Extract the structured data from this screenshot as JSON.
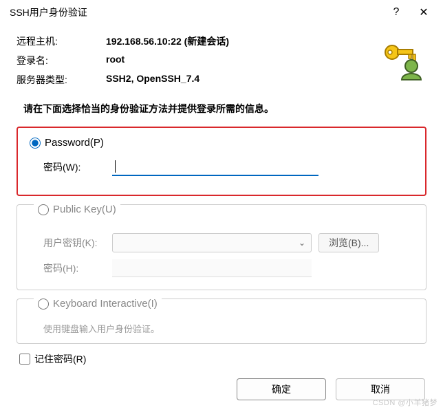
{
  "titlebar": {
    "title": "SSH用户身份验证",
    "help_glyph": "?",
    "close_glyph": "✕"
  },
  "info": {
    "remote_host_label": "远程主机:",
    "remote_host_value": "192.168.56.10:22 (新建会话)",
    "login_label": "登录名:",
    "login_value": "root",
    "server_type_label": "服务器类型:",
    "server_type_value": "SSH2, OpenSSH_7.4"
  },
  "instruction": "请在下面选择恰当的身份验证方法并提供登录所需的信息。",
  "password_group": {
    "radio_label": "Password(P)",
    "password_label": "密码(W):",
    "password_value": ""
  },
  "publickey_group": {
    "radio_label": "Public Key(U)",
    "userkey_label": "用户密钥(K):",
    "browse_label": "浏览(B)...",
    "passphrase_label": "密码(H):"
  },
  "keyboard_group": {
    "radio_label": "Keyboard Interactive(I)",
    "hint": "使用键盘输入用户身份验证。"
  },
  "remember": {
    "label": "记住密码(R)",
    "checked": false
  },
  "buttons": {
    "ok": "确定",
    "cancel": "取消"
  },
  "watermark": "CSDN @小羊猪梦"
}
